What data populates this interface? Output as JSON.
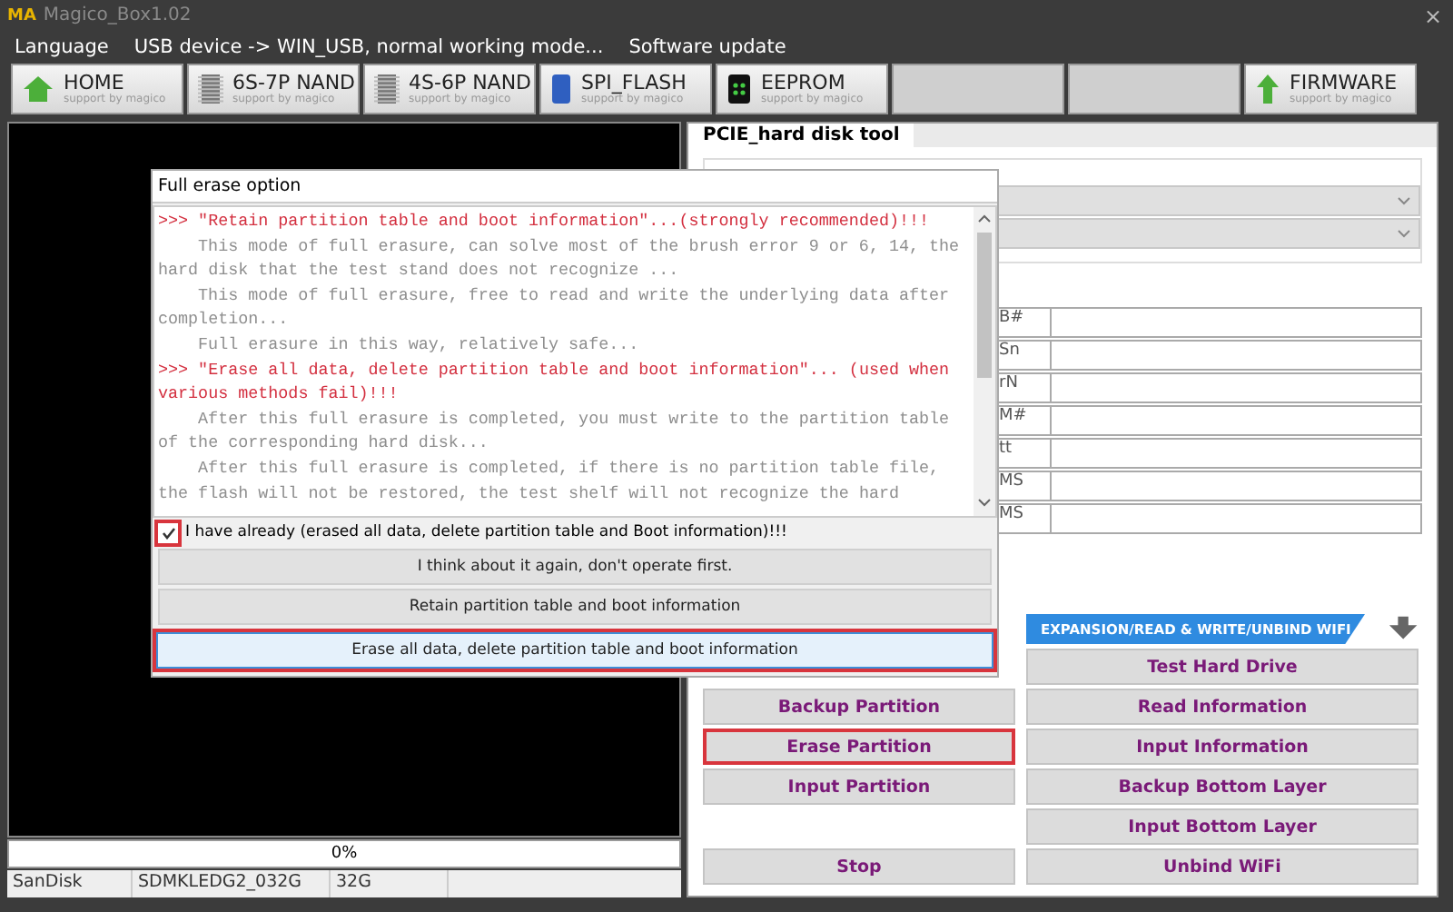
{
  "window": {
    "logo": "MA",
    "title": "Magico_Box1.02",
    "close": "×"
  },
  "menu": [
    "Language",
    "USB device -> WIN_USB, normal working mode...",
    "Software update"
  ],
  "toolbar": [
    {
      "kind": "home",
      "label": "HOME",
      "subtitle": "support by magico"
    },
    {
      "kind": "chip",
      "label": "6S-7P NAND",
      "subtitle": "support by magico"
    },
    {
      "kind": "chip",
      "label": "4S-6P NAND",
      "subtitle": "support by magico"
    },
    {
      "kind": "flash",
      "label": "SPI_FLASH",
      "subtitle": "support by magico"
    },
    {
      "kind": "eeprom",
      "label": "EEPROM",
      "subtitle": "support by magico"
    },
    {
      "kind": "blank"
    },
    {
      "kind": "blank"
    },
    {
      "kind": "firmware",
      "label": "FIRMWARE",
      "subtitle": "support by magico"
    }
  ],
  "progress": {
    "level": 0,
    "reading": "0%"
  },
  "status_bar": [
    "SanDisk",
    "SDMKLEDG2_032G",
    "32G"
  ],
  "tool_panel": {
    "tab": "PCIE_hard disk tool",
    "fields": [
      {
        "label": "B#"
      },
      {
        "label": "Sn"
      },
      {
        "label": "rN"
      },
      {
        "label": "M#"
      },
      {
        "label": "tt"
      },
      {
        "label": "MS"
      },
      {
        "label": "MS"
      }
    ],
    "section_tab": "EXPANSION/READ & WRITE/UNBIND WIFI",
    "left_buttons": [
      {
        "kind": "spacer"
      },
      {
        "kind": "button",
        "label": "Backup Partition",
        "highlighted": false
      },
      {
        "kind": "button",
        "label": "Erase Partition",
        "highlighted": true
      },
      {
        "kind": "button",
        "label": "Input Partition",
        "highlighted": false
      },
      {
        "kind": "spacer"
      },
      {
        "kind": "button",
        "label": "Stop",
        "highlighted": false
      }
    ],
    "right_buttons": [
      {
        "label": "Test Hard Drive"
      },
      {
        "label": "Read Information"
      },
      {
        "label": "Input Information"
      },
      {
        "label": "Backup Bottom Layer"
      },
      {
        "label": "Input Bottom Layer"
      },
      {
        "label": "Unbind WiFi"
      }
    ]
  },
  "dialog": {
    "title": "Full erase option",
    "paragraphs": [
      {
        "kind": "heading",
        "text": ">>> \"Retain partition table and boot information\"...(strongly recommended)!!!"
      },
      {
        "kind": "body",
        "text": "This mode of full erasure, can solve most of the brush error 9 or 6, 14, the hard disk that the test stand does not recognize ..."
      },
      {
        "kind": "body",
        "text": "This mode of full erasure, free to read and write the underlying data after completion..."
      },
      {
        "kind": "body",
        "text": "Full erasure in this way, relatively safe..."
      },
      {
        "kind": "heading",
        "text": ">>> \"Erase all data, delete partition table and boot information\"... (used when various methods fail)!!!"
      },
      {
        "kind": "body",
        "text": "After this full erasure is completed, you must write to the partition table of the corresponding hard disk..."
      },
      {
        "kind": "body",
        "text": "After this full erasure is completed, if there is no partition table file, the flash will not be restored, the test shelf will not recognize the hard"
      }
    ],
    "confirm": {
      "label": "I have already (erased all data, delete partition table and Boot information)!!!",
      "checked": true,
      "highlighted": true
    },
    "buttons": [
      {
        "label": "I think about it again, don't operate first.",
        "selected": false,
        "highlighted": false
      },
      {
        "label": "Retain partition table and boot information",
        "selected": false,
        "highlighted": false
      },
      {
        "label": "Erase all data, delete partition table and boot information",
        "selected": true,
        "highlighted": true
      }
    ]
  }
}
